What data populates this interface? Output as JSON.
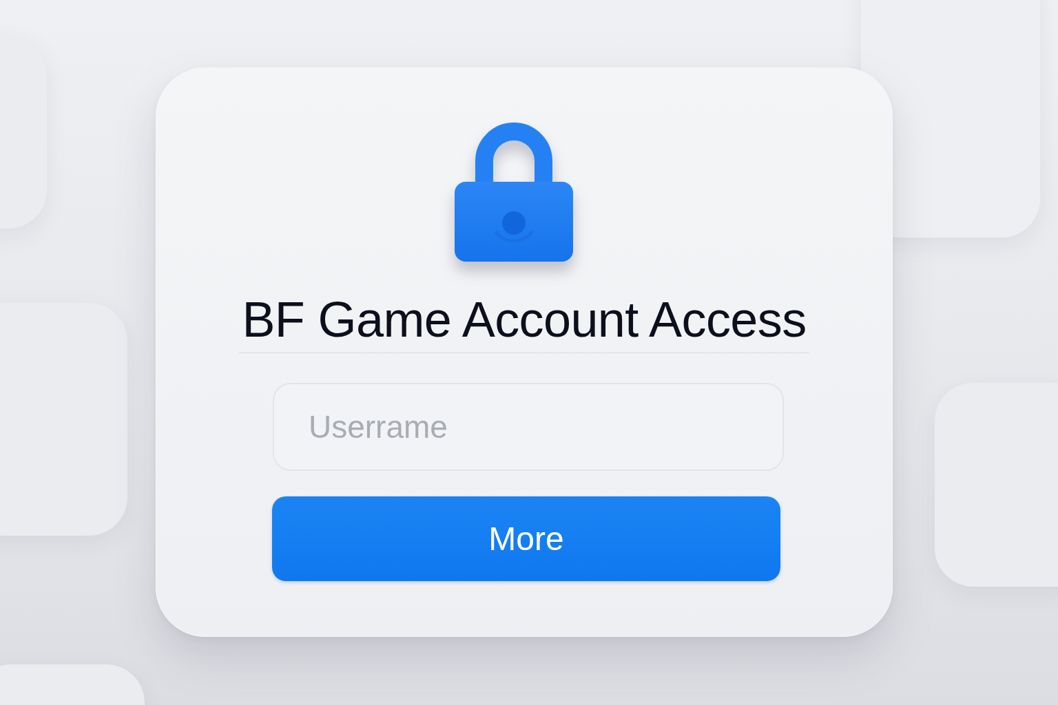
{
  "login_card": {
    "title": "BF Game Account Access",
    "username_field": {
      "placeholder": "Userrame"
    },
    "submit_button": {
      "label": "More"
    }
  }
}
